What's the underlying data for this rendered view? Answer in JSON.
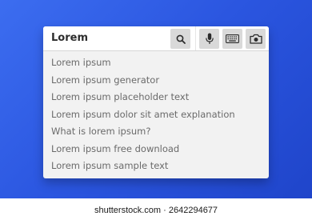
{
  "search": {
    "query": "Lorem",
    "search_icon": "magnifier-icon",
    "mic_icon": "microphone-icon",
    "keyboard_icon": "keyboard-icon",
    "camera_icon": "camera-icon"
  },
  "suggestions": [
    "Lorem ipsum",
    "Lorem ipsum generator",
    "Lorem ipsum placeholder text",
    "Lorem ipsum dolor sit amet explanation",
    "What is lorem ipsum?",
    "Lorem ipsum free download",
    "Lorem ipsum sample text"
  ],
  "watermark": {
    "text": "shutterstock.com · 2642294677"
  },
  "colors": {
    "background": "#2b56e0",
    "panel": "#f2f2f2",
    "button": "#d9d9d9",
    "suggestion_text": "#6a6a6a"
  }
}
